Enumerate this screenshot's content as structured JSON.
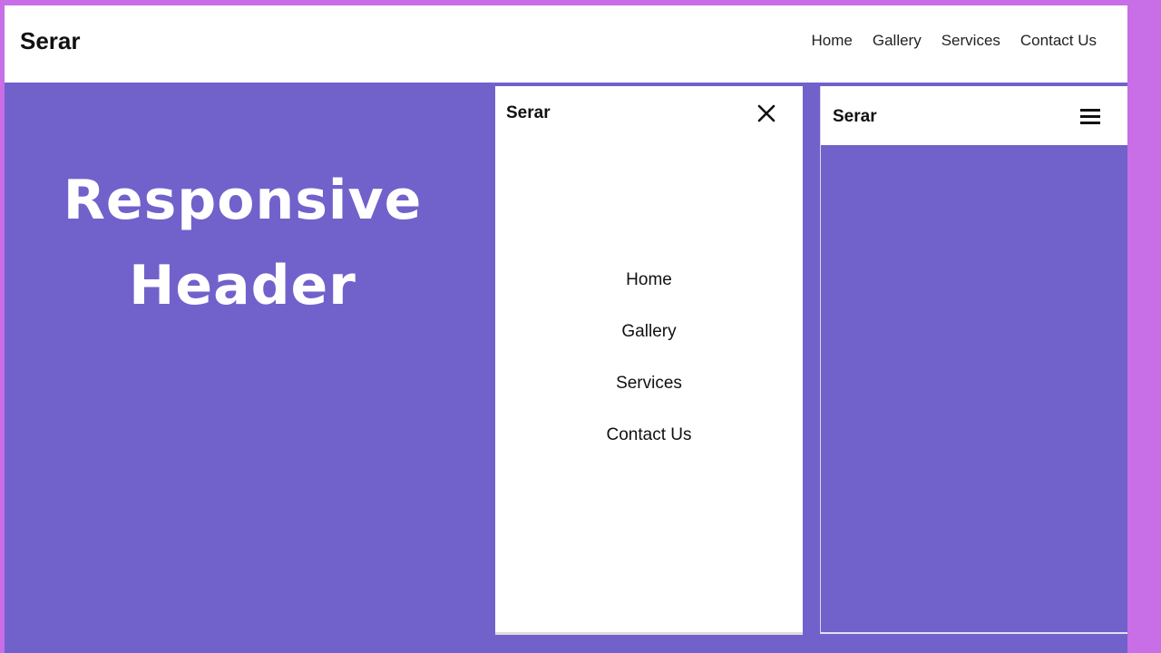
{
  "brand": "Serar",
  "desktop_nav": {
    "items": [
      "Home",
      "Gallery",
      "Services",
      "Contact Us"
    ]
  },
  "hero": {
    "line1": "Responsive",
    "line2": "Header"
  },
  "mobile_open": {
    "logo": "Serar",
    "close_icon": "close-icon",
    "items": [
      "Home",
      "Gallery",
      "Services",
      "Contact Us"
    ]
  },
  "mobile_closed": {
    "logo": "Serar",
    "menu_icon": "hamburger-icon"
  },
  "colors": {
    "page_bg": "#c86ee6",
    "purple_bg": "#7161cb",
    "header_bg": "#ffffff",
    "text": "#111111"
  }
}
